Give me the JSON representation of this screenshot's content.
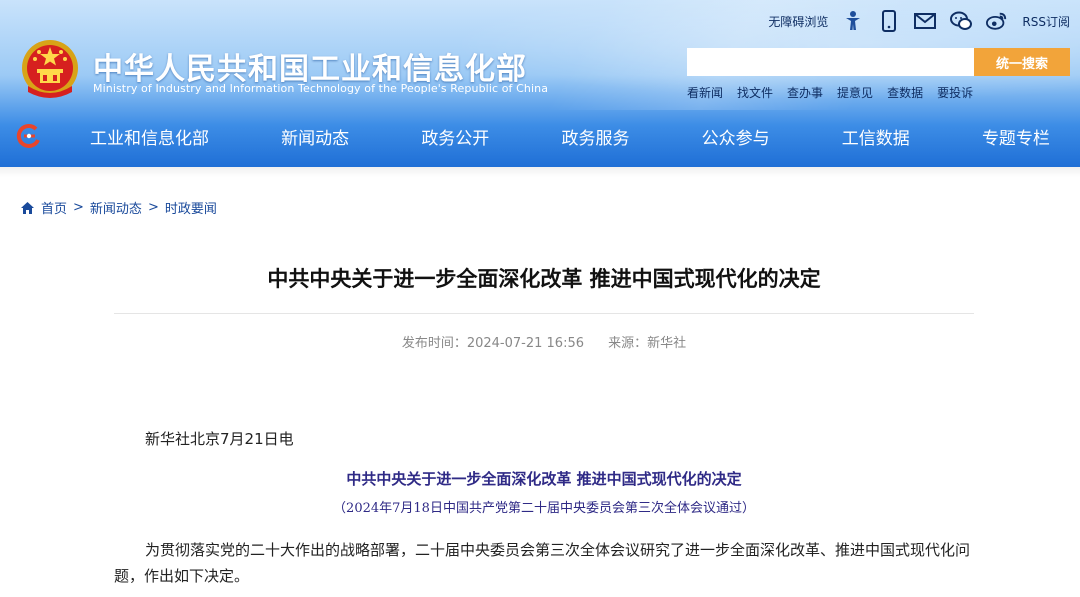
{
  "header": {
    "site_title": "中华人民共和国工业和信息化部",
    "site_subtitle": "Ministry of Industry and Information Technology of the People's Republic of China",
    "tools": {
      "accessibility": "无障碍浏览",
      "rss": "RSS订阅"
    },
    "search": {
      "placeholder": "",
      "button_label": "统一搜索"
    },
    "quick_links": [
      "看新闻",
      "找文件",
      "查办事",
      "提意见",
      "查数据",
      "要投诉"
    ],
    "nav": [
      "工业和信息化部",
      "新闻动态",
      "政务公开",
      "政务服务",
      "公众参与",
      "工信数据",
      "专题专栏"
    ]
  },
  "breadcrumb": {
    "home": "首页",
    "sep": ">",
    "level1": "新闻动态",
    "level2": "时政要闻"
  },
  "article": {
    "title": "中共中央关于进一步全面深化改革 推进中国式现代化的决定",
    "published": "发布时间：2024-07-21 16:56",
    "source": "来源：新华社",
    "dateline": "新华社北京7月21日电",
    "sub_title": "中共中央关于进一步全面深化改革 推进中国式现代化的决定",
    "sub_note": "（2024年7月18日中国共产党第二十届中央委员会第三次全体会议通过）",
    "paragraph": "为贯彻落实党的二十大作出的战略部署，二十届中央委员会第三次全体会议研究了进一步全面深化改革、推进中国式现代化问题，作出如下决定。"
  },
  "colors": {
    "search_button": "#f2a43a",
    "header_dark": "#1f6fd6",
    "subtitle_text": "#2f2a86",
    "breadcrumb_link": "#1a4a9b"
  },
  "icons": [
    "national-emblem-icon",
    "accessibility-icon",
    "mobile-icon",
    "mail-icon",
    "wechat-icon",
    "weibo-icon",
    "home-icon",
    "site-logo-icon"
  ]
}
